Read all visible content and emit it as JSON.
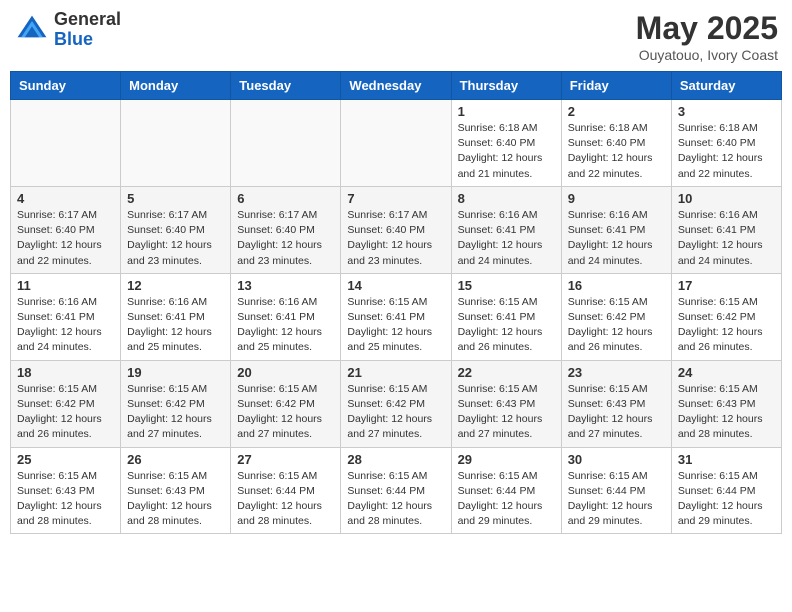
{
  "header": {
    "logo_general": "General",
    "logo_blue": "Blue",
    "month_title": "May 2025",
    "subtitle": "Ouyatouo, Ivory Coast"
  },
  "days_of_week": [
    "Sunday",
    "Monday",
    "Tuesday",
    "Wednesday",
    "Thursday",
    "Friday",
    "Saturday"
  ],
  "weeks": [
    [
      {
        "day": "",
        "info": ""
      },
      {
        "day": "",
        "info": ""
      },
      {
        "day": "",
        "info": ""
      },
      {
        "day": "",
        "info": ""
      },
      {
        "day": "1",
        "info": "Sunrise: 6:18 AM\nSunset: 6:40 PM\nDaylight: 12 hours\nand 21 minutes."
      },
      {
        "day": "2",
        "info": "Sunrise: 6:18 AM\nSunset: 6:40 PM\nDaylight: 12 hours\nand 22 minutes."
      },
      {
        "day": "3",
        "info": "Sunrise: 6:18 AM\nSunset: 6:40 PM\nDaylight: 12 hours\nand 22 minutes."
      }
    ],
    [
      {
        "day": "4",
        "info": "Sunrise: 6:17 AM\nSunset: 6:40 PM\nDaylight: 12 hours\nand 22 minutes."
      },
      {
        "day": "5",
        "info": "Sunrise: 6:17 AM\nSunset: 6:40 PM\nDaylight: 12 hours\nand 23 minutes."
      },
      {
        "day": "6",
        "info": "Sunrise: 6:17 AM\nSunset: 6:40 PM\nDaylight: 12 hours\nand 23 minutes."
      },
      {
        "day": "7",
        "info": "Sunrise: 6:17 AM\nSunset: 6:40 PM\nDaylight: 12 hours\nand 23 minutes."
      },
      {
        "day": "8",
        "info": "Sunrise: 6:16 AM\nSunset: 6:41 PM\nDaylight: 12 hours\nand 24 minutes."
      },
      {
        "day": "9",
        "info": "Sunrise: 6:16 AM\nSunset: 6:41 PM\nDaylight: 12 hours\nand 24 minutes."
      },
      {
        "day": "10",
        "info": "Sunrise: 6:16 AM\nSunset: 6:41 PM\nDaylight: 12 hours\nand 24 minutes."
      }
    ],
    [
      {
        "day": "11",
        "info": "Sunrise: 6:16 AM\nSunset: 6:41 PM\nDaylight: 12 hours\nand 24 minutes."
      },
      {
        "day": "12",
        "info": "Sunrise: 6:16 AM\nSunset: 6:41 PM\nDaylight: 12 hours\nand 25 minutes."
      },
      {
        "day": "13",
        "info": "Sunrise: 6:16 AM\nSunset: 6:41 PM\nDaylight: 12 hours\nand 25 minutes."
      },
      {
        "day": "14",
        "info": "Sunrise: 6:15 AM\nSunset: 6:41 PM\nDaylight: 12 hours\nand 25 minutes."
      },
      {
        "day": "15",
        "info": "Sunrise: 6:15 AM\nSunset: 6:41 PM\nDaylight: 12 hours\nand 26 minutes."
      },
      {
        "day": "16",
        "info": "Sunrise: 6:15 AM\nSunset: 6:42 PM\nDaylight: 12 hours\nand 26 minutes."
      },
      {
        "day": "17",
        "info": "Sunrise: 6:15 AM\nSunset: 6:42 PM\nDaylight: 12 hours\nand 26 minutes."
      }
    ],
    [
      {
        "day": "18",
        "info": "Sunrise: 6:15 AM\nSunset: 6:42 PM\nDaylight: 12 hours\nand 26 minutes."
      },
      {
        "day": "19",
        "info": "Sunrise: 6:15 AM\nSunset: 6:42 PM\nDaylight: 12 hours\nand 27 minutes."
      },
      {
        "day": "20",
        "info": "Sunrise: 6:15 AM\nSunset: 6:42 PM\nDaylight: 12 hours\nand 27 minutes."
      },
      {
        "day": "21",
        "info": "Sunrise: 6:15 AM\nSunset: 6:42 PM\nDaylight: 12 hours\nand 27 minutes."
      },
      {
        "day": "22",
        "info": "Sunrise: 6:15 AM\nSunset: 6:43 PM\nDaylight: 12 hours\nand 27 minutes."
      },
      {
        "day": "23",
        "info": "Sunrise: 6:15 AM\nSunset: 6:43 PM\nDaylight: 12 hours\nand 27 minutes."
      },
      {
        "day": "24",
        "info": "Sunrise: 6:15 AM\nSunset: 6:43 PM\nDaylight: 12 hours\nand 28 minutes."
      }
    ],
    [
      {
        "day": "25",
        "info": "Sunrise: 6:15 AM\nSunset: 6:43 PM\nDaylight: 12 hours\nand 28 minutes."
      },
      {
        "day": "26",
        "info": "Sunrise: 6:15 AM\nSunset: 6:43 PM\nDaylight: 12 hours\nand 28 minutes."
      },
      {
        "day": "27",
        "info": "Sunrise: 6:15 AM\nSunset: 6:44 PM\nDaylight: 12 hours\nand 28 minutes."
      },
      {
        "day": "28",
        "info": "Sunrise: 6:15 AM\nSunset: 6:44 PM\nDaylight: 12 hours\nand 28 minutes."
      },
      {
        "day": "29",
        "info": "Sunrise: 6:15 AM\nSunset: 6:44 PM\nDaylight: 12 hours\nand 29 minutes."
      },
      {
        "day": "30",
        "info": "Sunrise: 6:15 AM\nSunset: 6:44 PM\nDaylight: 12 hours\nand 29 minutes."
      },
      {
        "day": "31",
        "info": "Sunrise: 6:15 AM\nSunset: 6:44 PM\nDaylight: 12 hours\nand 29 minutes."
      }
    ]
  ]
}
